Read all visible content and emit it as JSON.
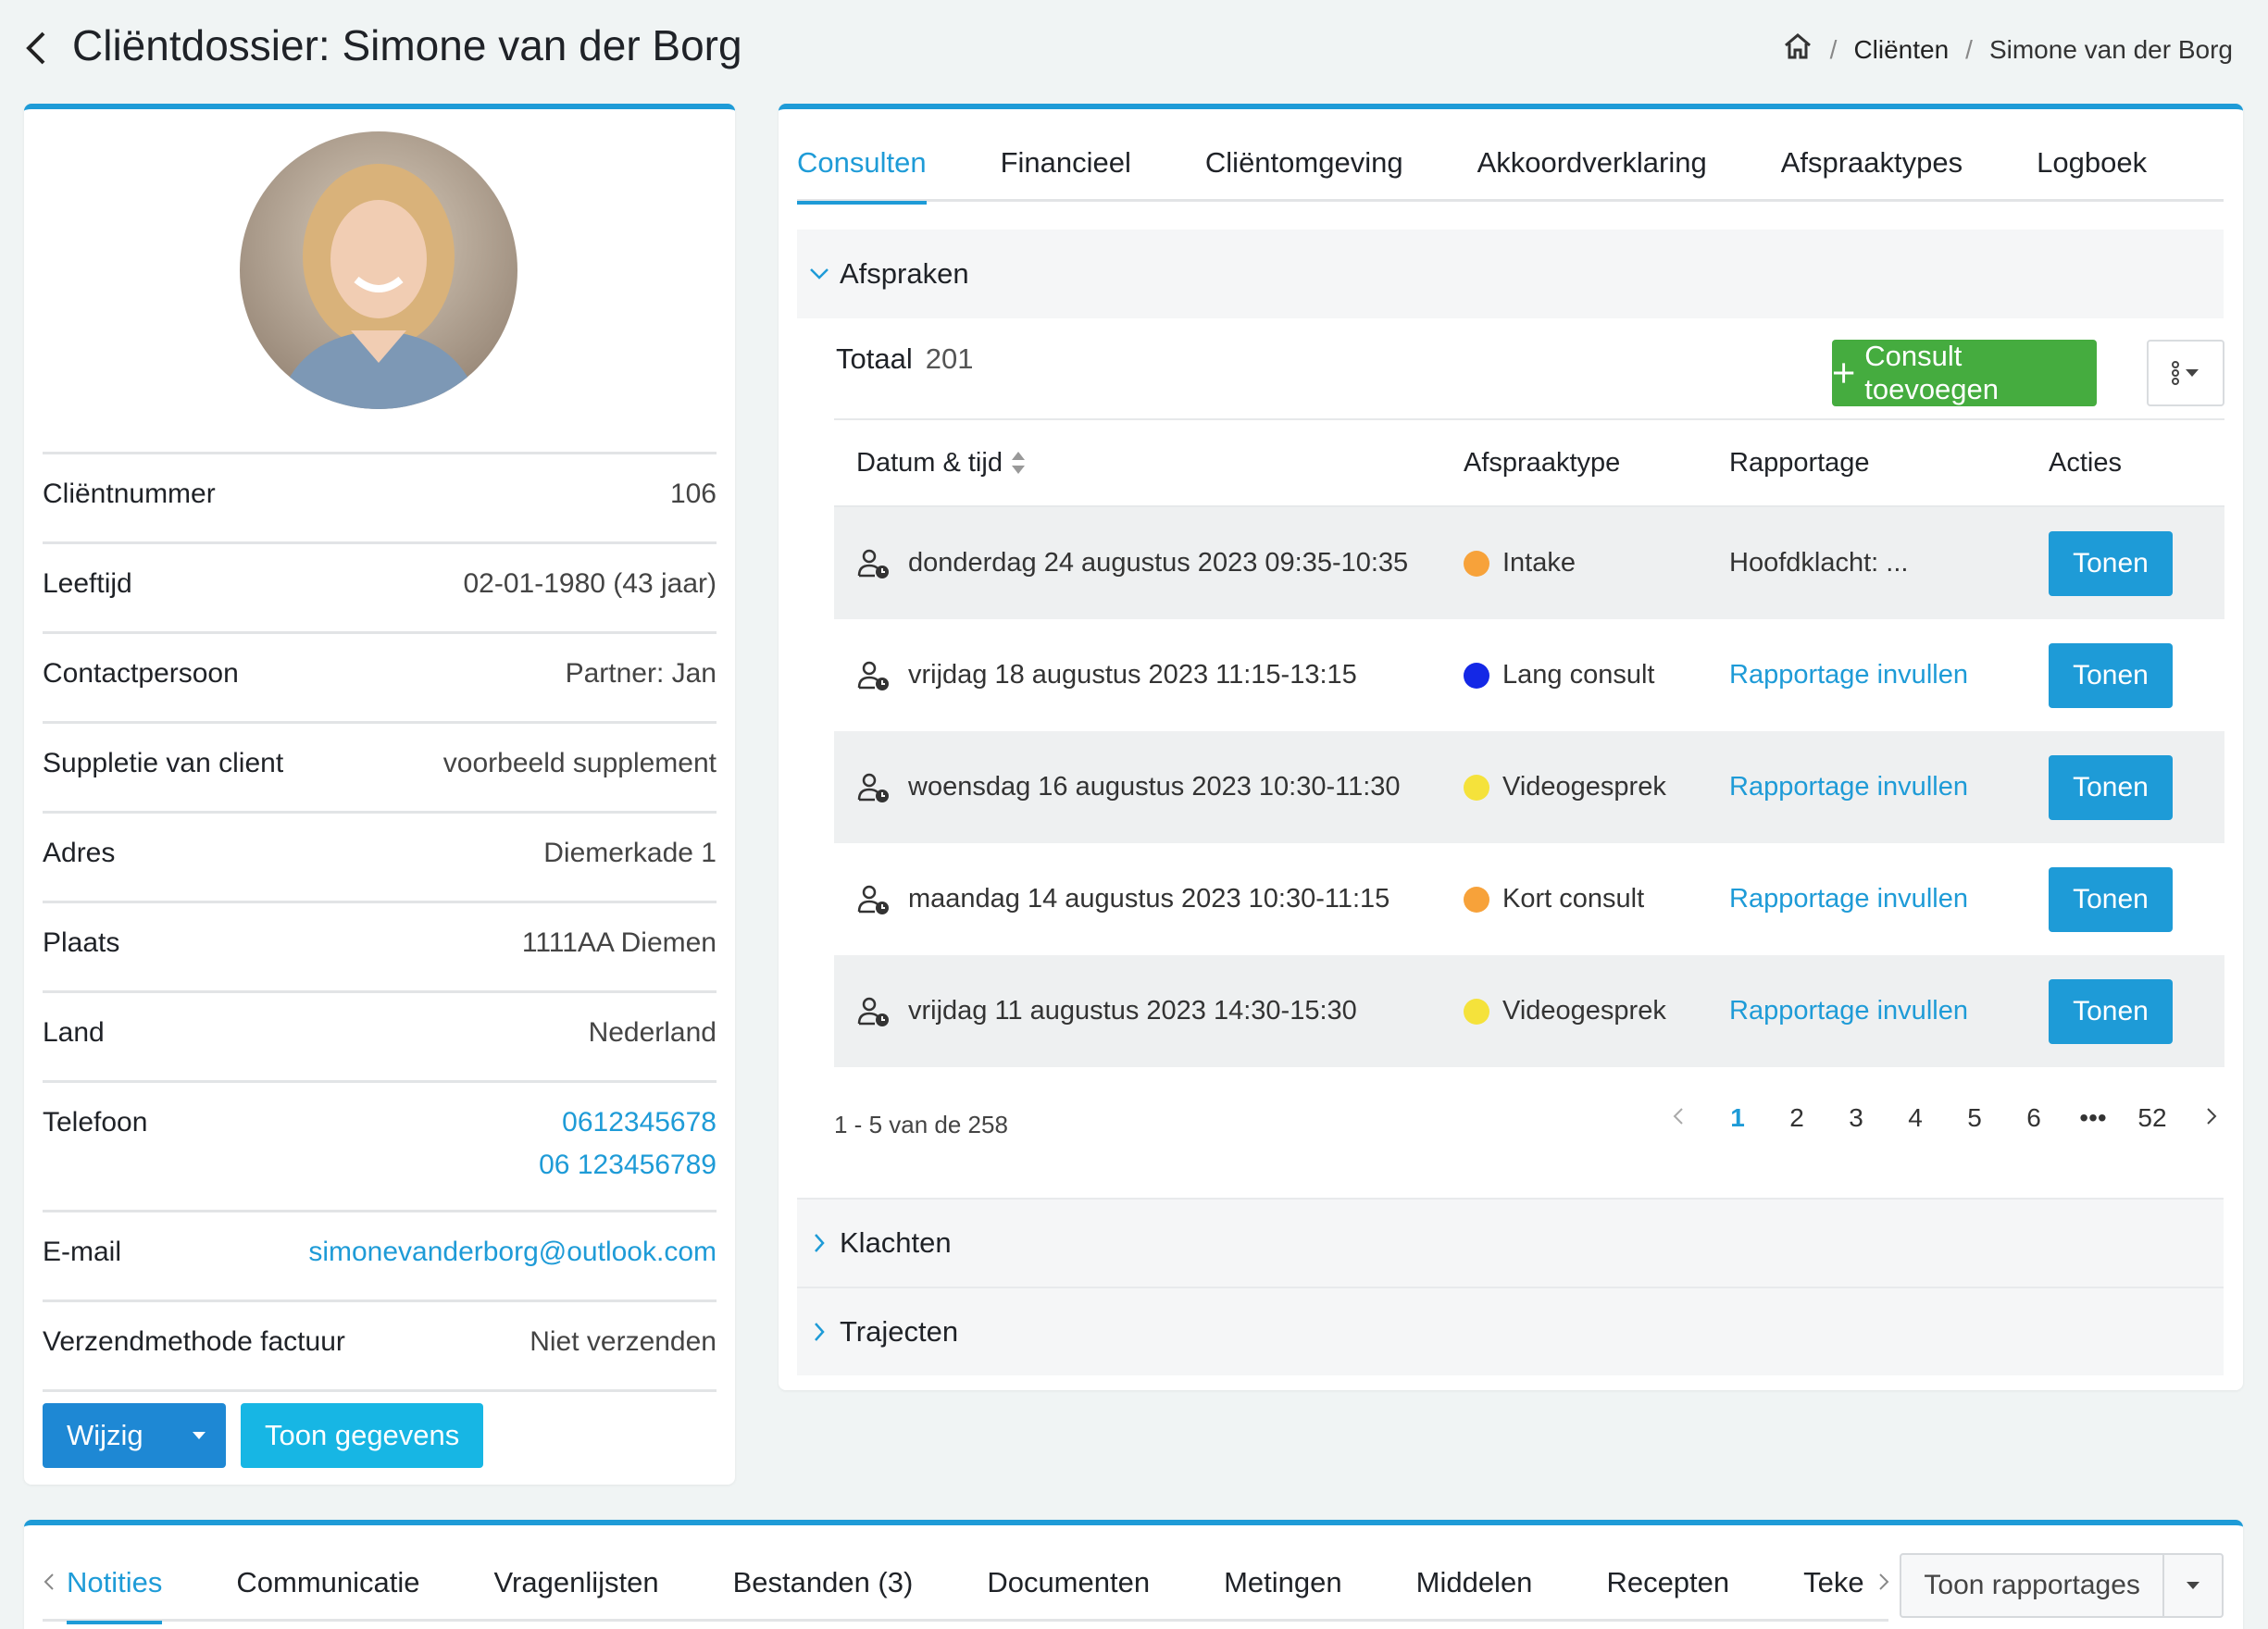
{
  "header": {
    "title": "Cliëntdossier: Simone van der Borg",
    "breadcrumb": {
      "home_icon": "home-icon",
      "clients": "Cliënten",
      "current": "Simone van der Borg",
      "separator": "/"
    }
  },
  "client": {
    "fields": [
      {
        "label": "Cliëntnummer",
        "value": "106"
      },
      {
        "label": "Leeftijd",
        "value": "02-01-1980 (43 jaar)"
      },
      {
        "label": "Contactpersoon",
        "value": "Partner: Jan"
      },
      {
        "label": "Suppletie van client",
        "value": "voorbeeld supplement"
      },
      {
        "label": "Adres",
        "value": "Diemerkade 1"
      },
      {
        "label": "Plaats",
        "value": "1111AA Diemen"
      },
      {
        "label": "Land",
        "value": "Nederland"
      },
      {
        "label": "Telefoon",
        "phone1": "0612345678",
        "phone2": "06 123456789"
      },
      {
        "label": "E-mail",
        "value": "simonevanderborg@outlook.com"
      },
      {
        "label": "Verzendmethode factuur",
        "value": "Niet verzenden"
      }
    ],
    "actions": {
      "edit": "Wijzig",
      "show": "Toon gegevens"
    }
  },
  "tabs": [
    "Consulten",
    "Financieel",
    "Cliëntomgeving",
    "Akkoordverklaring",
    "Afspraaktypes",
    "Logboek"
  ],
  "appointments": {
    "section_title": "Afspraken",
    "total_label": "Totaal",
    "total_count": "201",
    "add_button": "Consult toevoegen",
    "columns": [
      "Datum & tijd",
      "Afspraaktype",
      "Rapportage",
      "Acties"
    ],
    "rows": [
      {
        "date": "donderdag 24 augustus 2023 09:35-10:35",
        "type": "Intake",
        "type_color": "#f7a23a",
        "report": "Hoofdklacht: ...",
        "report_is_link": false,
        "action": "Tonen"
      },
      {
        "date": "vrijdag 18 augustus 2023 11:15-13:15",
        "type": "Lang consult",
        "type_color": "#1428e6",
        "report": "Rapportage invullen",
        "report_is_link": true,
        "action": "Tonen"
      },
      {
        "date": "woensdag 16 augustus 2023 10:30-11:30",
        "type": "Videogesprek",
        "type_color": "#f5e23b",
        "report": "Rapportage invullen",
        "report_is_link": true,
        "action": "Tonen"
      },
      {
        "date": "maandag 14 augustus 2023 10:30-11:15",
        "type": "Kort consult",
        "type_color": "#f7a23a",
        "report": "Rapportage invullen",
        "report_is_link": true,
        "action": "Tonen"
      },
      {
        "date": "vrijdag 11 augustus 2023 14:30-15:30",
        "type": "Videogesprek",
        "type_color": "#f5e23b",
        "report": "Rapportage invullen",
        "report_is_link": true,
        "action": "Tonen"
      }
    ],
    "pagination": {
      "info": "1 - 5 van de 258",
      "pages": [
        "1",
        "2",
        "3",
        "4",
        "5",
        "6",
        "•••",
        "52"
      ],
      "current": "1"
    }
  },
  "sections": {
    "complaints": "Klachten",
    "trajectories": "Trajecten"
  },
  "bottom": {
    "tabs": [
      "Notities",
      "Communicatie",
      "Vragenlijsten",
      "Bestanden (3)",
      "Documenten",
      "Metingen",
      "Middelen",
      "Recepten",
      "Teke"
    ],
    "report_button": "Toon rapportages"
  },
  "colors": {
    "accent": "#1e9bd7",
    "green": "#45ac3f",
    "cyan": "#17b6e4"
  }
}
